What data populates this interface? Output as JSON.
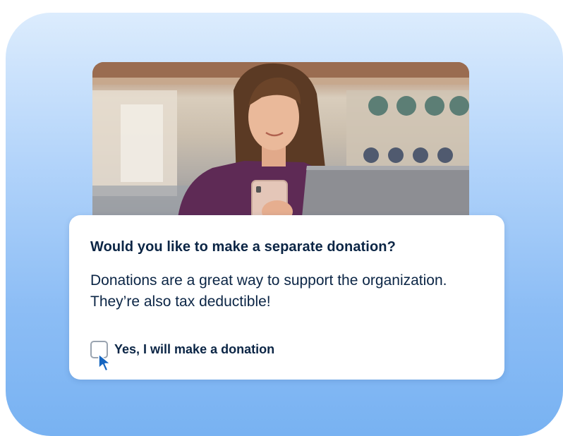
{
  "prompt": {
    "title": "Would you like to make a separate donation?",
    "description": "Donations are a great way to support the organization. They’re also tax deductible!",
    "checkbox": {
      "label": "Yes, I will make a donation",
      "checked": false
    }
  },
  "icons": {
    "pointer": "mouse-pointer-icon"
  },
  "colors": {
    "accent_text": "#0b2545",
    "pointer": "#1565c0",
    "background_top": "#dcecfd",
    "background_bottom": "#78b2f2"
  }
}
